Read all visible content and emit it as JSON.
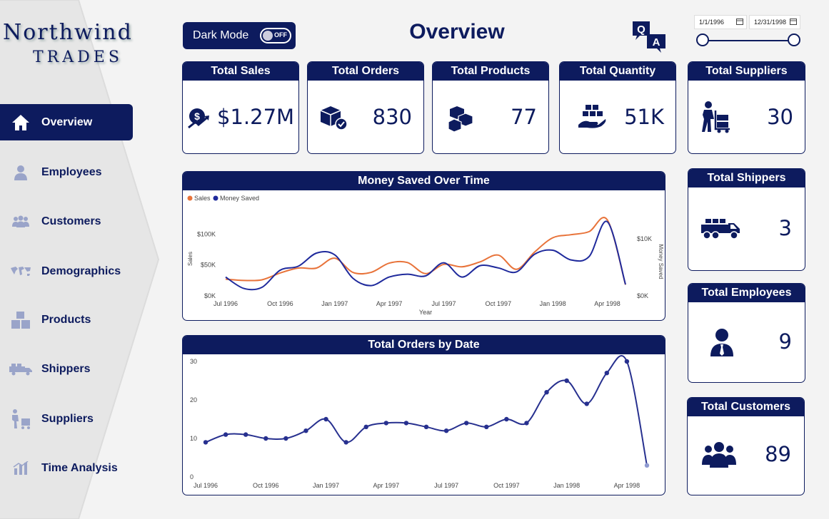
{
  "logo": {
    "line1": "Northwind",
    "line2": "TRADES"
  },
  "nav": [
    {
      "label": "Overview",
      "icon": "home-icon",
      "active": true
    },
    {
      "label": "Employees",
      "icon": "person-icon"
    },
    {
      "label": "Customers",
      "icon": "group-icon"
    },
    {
      "label": "Demographics",
      "icon": "world-map-icon"
    },
    {
      "label": "Products",
      "icon": "boxes-icon"
    },
    {
      "label": "Shippers",
      "icon": "truck-icon"
    },
    {
      "label": "Suppliers",
      "icon": "dolly-worker-icon"
    },
    {
      "label": "Time Analysis",
      "icon": "bar-chart-icon"
    }
  ],
  "header": {
    "dark_mode_label": "Dark Mode",
    "dark_mode_state": "OFF",
    "title": "Overview",
    "date_from": "1/1/1996",
    "date_to": "12/31/1998"
  },
  "kpis": {
    "sales": {
      "title": "Total Sales",
      "value": "$1.27M"
    },
    "orders": {
      "title": "Total Orders",
      "value": "830"
    },
    "products": {
      "title": "Total Products",
      "value": "77"
    },
    "quantity": {
      "title": "Total Quantity",
      "value": "51K"
    },
    "suppliers": {
      "title": "Total Suppliers",
      "value": "30"
    },
    "shippers": {
      "title": "Total Shippers",
      "value": "3"
    },
    "employees": {
      "title": "Total Employees",
      "value": "9"
    },
    "customers": {
      "title": "Total Customers",
      "value": "89"
    }
  },
  "colors": {
    "navy": "#0d1b5e",
    "sales_line": "#e8733a",
    "saved_line": "#1f2a9c",
    "orders_line": "#27308f"
  },
  "chart_data": [
    {
      "type": "line",
      "title": "Money Saved Over Time",
      "xlabel": "Year",
      "ylabel": "Sales",
      "y2label": "Money Saved",
      "x_ticks": [
        "Jul 1996",
        "Oct 1996",
        "Jan 1997",
        "Apr 1997",
        "Jul 1997",
        "Oct 1997",
        "Jan 1998",
        "Apr 1998"
      ],
      "y_ticks": [
        "$0K",
        "$50K",
        "$100K"
      ],
      "y2_ticks": [
        "$0K",
        "$10K"
      ],
      "ylim": [
        0,
        120000
      ],
      "y2lim": [
        0,
        13000
      ],
      "legend": "top-left",
      "x": [
        "Jul 1996",
        "Aug 1996",
        "Sep 1996",
        "Oct 1996",
        "Nov 1996",
        "Dec 1996",
        "Jan 1997",
        "Feb 1997",
        "Mar 1997",
        "Apr 1997",
        "May 1997",
        "Jun 1997",
        "Jul 1997",
        "Aug 1997",
        "Sep 1997",
        "Oct 1997",
        "Nov 1997",
        "Dec 1997",
        "Jan 1998",
        "Feb 1998",
        "Mar 1998",
        "Apr 1998",
        "May 1998"
      ],
      "series": [
        {
          "name": "Sales",
          "axis": "left",
          "values": [
            27000,
            25000,
            26000,
            37000,
            45000,
            45000,
            61000,
            38000,
            38000,
            53000,
            54000,
            36000,
            51000,
            47000,
            55000,
            66000,
            43000,
            71000,
            94000,
            99000,
            104000,
            123000,
            18000
          ]
        },
        {
          "name": "Money Saved",
          "axis": "right",
          "values": [
            3300,
            1300,
            1500,
            4500,
            5200,
            7500,
            7200,
            3100,
            1800,
            3300,
            3800,
            3500,
            5800,
            3300,
            5300,
            4900,
            4200,
            7300,
            8000,
            6300,
            6900,
            13000,
            2000
          ]
        }
      ]
    },
    {
      "type": "line",
      "title": "Total Orders by Date",
      "x_ticks": [
        "Jul 1996",
        "Oct 1996",
        "Jan 1997",
        "Apr 1997",
        "Jul 1997",
        "Oct 1997",
        "Jan 1998",
        "Apr 1998"
      ],
      "y_ticks": [
        "0",
        "10",
        "20",
        "30"
      ],
      "ylim": [
        0,
        30
      ],
      "x": [
        "Jul 1996",
        "Aug 1996",
        "Sep 1996",
        "Oct 1996",
        "Nov 1996",
        "Dec 1996",
        "Jan 1997",
        "Feb 1997",
        "Mar 1997",
        "Apr 1997",
        "May 1997",
        "Jun 1997",
        "Jul 1997",
        "Aug 1997",
        "Sep 1997",
        "Oct 1997",
        "Nov 1997",
        "Dec 1997",
        "Jan 1998",
        "Feb 1998",
        "Mar 1998",
        "Apr 1998",
        "May 1998"
      ],
      "series": [
        {
          "values": [
            9,
            11,
            11,
            10,
            10,
            12,
            15,
            9,
            13,
            14,
            14,
            13,
            12,
            14,
            13,
            15,
            14,
            22,
            25,
            19,
            27,
            30,
            3
          ]
        }
      ]
    }
  ]
}
